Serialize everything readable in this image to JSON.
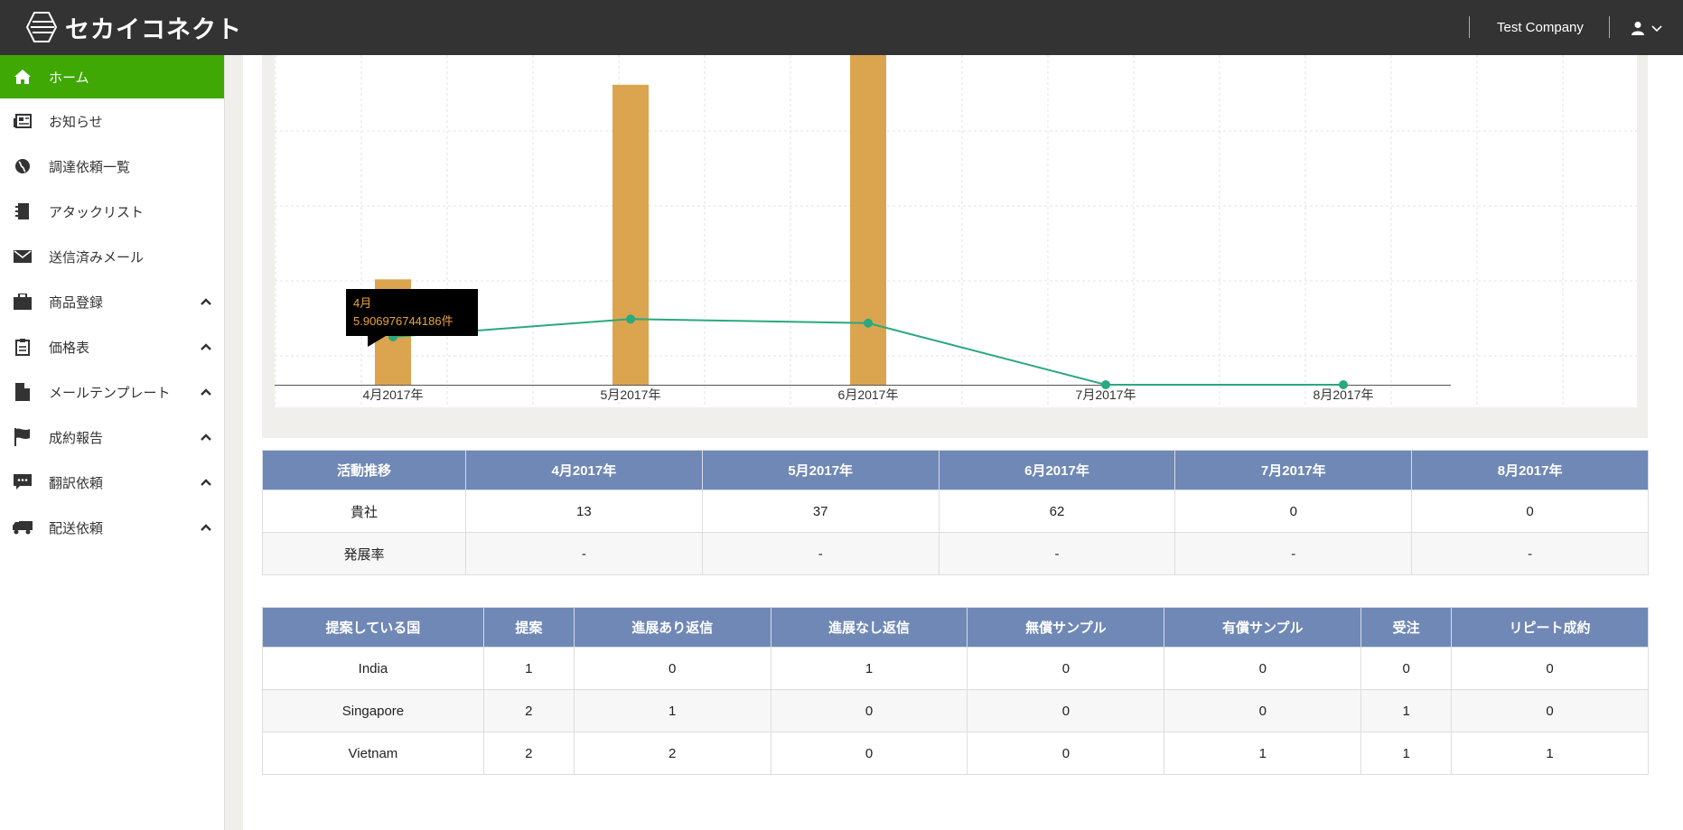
{
  "app": {
    "logo_text": "セカイコネクト",
    "company": "Test Company"
  },
  "sidebar": {
    "items": [
      {
        "label": "ホーム",
        "icon": "home-icon"
      },
      {
        "label": "お知らせ",
        "icon": "newspaper-icon"
      },
      {
        "label": "調達依頼一覧",
        "icon": "globe-icon"
      },
      {
        "label": "アタックリスト",
        "icon": "notebook-icon"
      },
      {
        "label": "送信済みメール",
        "icon": "envelope-icon"
      },
      {
        "label": "商品登録",
        "icon": "briefcase-icon"
      },
      {
        "label": "価格表",
        "icon": "clipboard-icon"
      },
      {
        "label": "メールテンプレート",
        "icon": "file-icon"
      },
      {
        "label": "成約報告",
        "icon": "flag-icon"
      },
      {
        "label": "翻訳依頼",
        "icon": "comment-icon"
      },
      {
        "label": "配送依頼",
        "icon": "truck-icon"
      }
    ]
  },
  "chart_data": {
    "type": "bar",
    "categories": [
      "4月2017年",
      "5月2017年",
      "6月2017年",
      "7月2017年",
      "8月2017年"
    ],
    "series": [
      {
        "type": "bar",
        "values": [
          13,
          37,
          62,
          0,
          0
        ],
        "color": "#dba54f"
      },
      {
        "type": "line",
        "values": [
          5.906976744186,
          8.1,
          7.6,
          0,
          0
        ],
        "color": "#2aa882"
      }
    ],
    "ylim": [
      0,
      44
    ],
    "grid": true,
    "tooltip": {
      "title": "4月",
      "value": "5.906976744186件"
    }
  },
  "activity_table": {
    "headers": [
      "活動推移",
      "4月2017年",
      "5月2017年",
      "6月2017年",
      "7月2017年",
      "8月2017年"
    ],
    "rows": [
      [
        "貴社",
        "13",
        "37",
        "62",
        "0",
        "0"
      ],
      [
        "発展率",
        "-",
        "-",
        "-",
        "-",
        "-"
      ]
    ]
  },
  "country_table": {
    "headers": [
      "提案している国",
      "提案",
      "進展あり返信",
      "進展なし返信",
      "無償サンプル",
      "有償サンプル",
      "受注",
      "リピート成約"
    ],
    "rows": [
      [
        "India",
        "1",
        "0",
        "1",
        "0",
        "0",
        "0",
        "0"
      ],
      [
        "Singapore",
        "2",
        "1",
        "0",
        "0",
        "0",
        "1",
        "0"
      ],
      [
        "Vietnam",
        "2",
        "2",
        "0",
        "0",
        "1",
        "1",
        "1"
      ]
    ]
  }
}
